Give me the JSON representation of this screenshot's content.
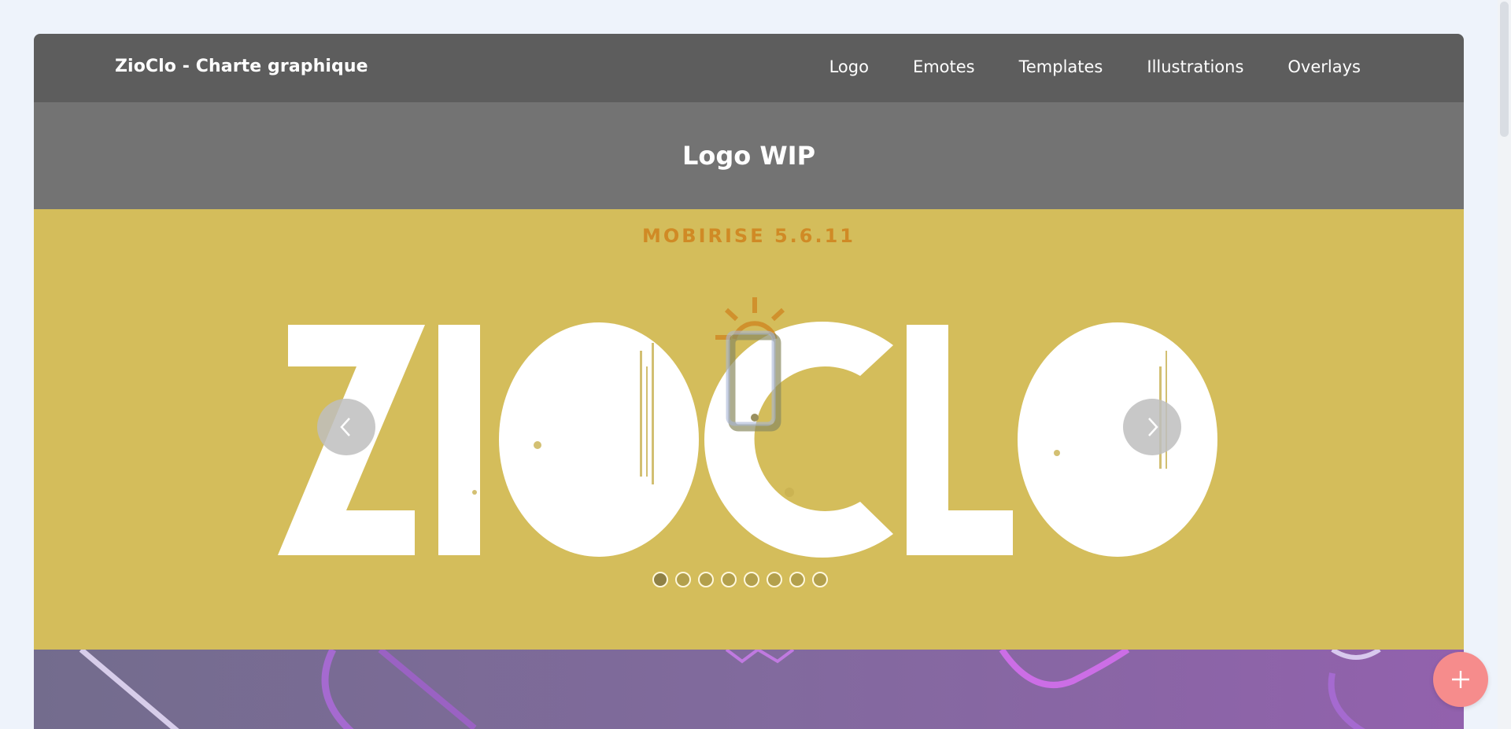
{
  "nav": {
    "brand": "ZioClo - Charte graphique",
    "links": [
      "Logo",
      "Emotes",
      "Templates",
      "Illustrations",
      "Overlays"
    ]
  },
  "section": {
    "title": "Logo WIP"
  },
  "slider": {
    "caption": "MOBIRISE  5.6.11",
    "logo_text": "ZIOCLO",
    "slide_count": 8,
    "active_slide": 1,
    "prev_icon": "chevron-left-icon",
    "next_icon": "chevron-right-icon"
  },
  "fab": {
    "icon": "plus-icon"
  },
  "colors": {
    "nav_bg": "#5d5d5d",
    "title_bg": "#737373",
    "slider_bg": "#d4bd5b",
    "caption": "#d08a25",
    "fab": "#f68c8c",
    "page_bg": "#eef3fb"
  }
}
